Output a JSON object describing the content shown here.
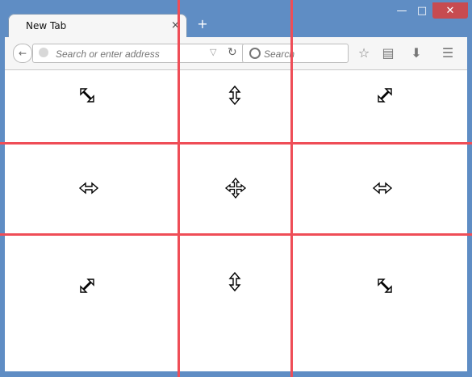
{
  "window": {
    "tab_title": "New Tab",
    "close_tab_glyph": "×",
    "new_tab_glyph": "+",
    "controls": {
      "minimize": "—",
      "maximize": "□",
      "close": "✕"
    }
  },
  "navigation": {
    "address_placeholder": "Search or enter address",
    "search_placeholder": "Search",
    "dropdown_glyph": "▽",
    "reload_glyph": "↻",
    "toolbar_icons": [
      "star-icon",
      "clipboard-icon",
      "download-icon",
      "menu-icon"
    ]
  },
  "grid_lines": {
    "color": "#ef4d57"
  },
  "cursors": {
    "top_left": "nwse-resize",
    "top_middle": "ns-resize",
    "top_right": "nesw-resize",
    "middle_left": "ew-resize",
    "center": "move",
    "middle_right": "ew-resize",
    "bottom_left": "nesw-resize",
    "bottom_middle": "ns-resize",
    "bottom_right": "nwse-resize"
  }
}
